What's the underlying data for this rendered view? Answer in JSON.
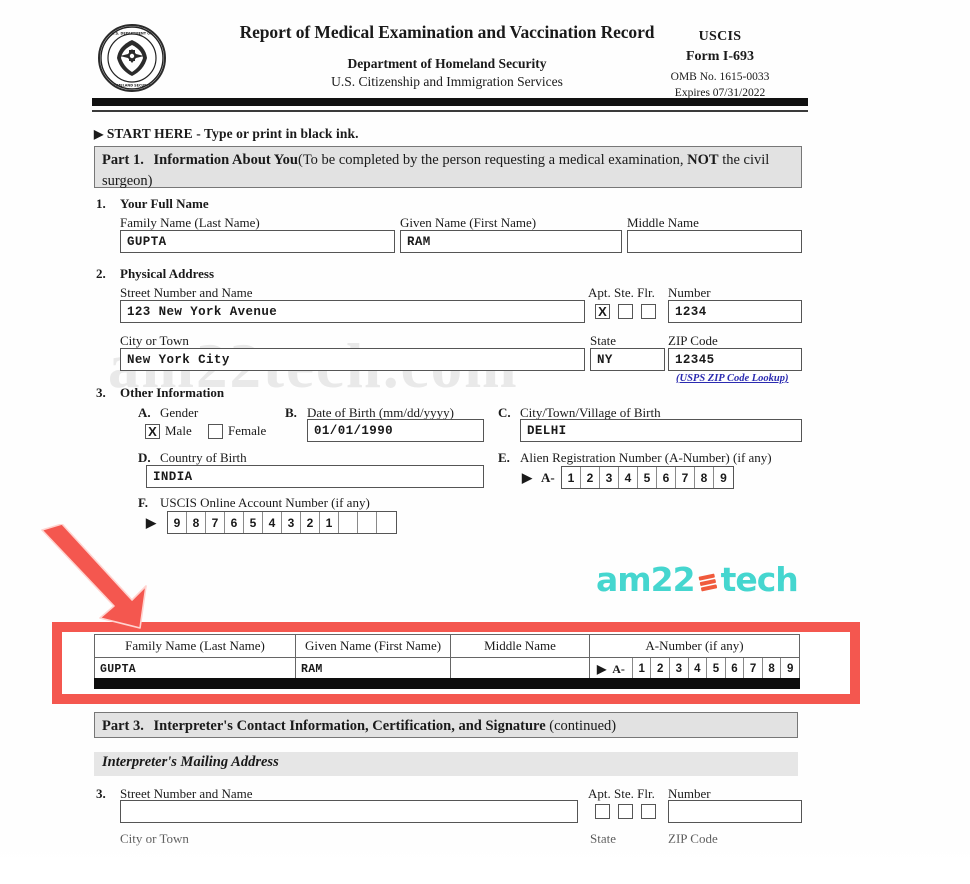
{
  "document": {
    "title": "Report of Medical Examination and Vaccination Record",
    "department": "Department of Homeland Security",
    "agency": "U.S. Citizenship and Immigration Services",
    "seal_alt": "dhs-seal",
    "agency_short": "USCIS",
    "form_number": "Form I-693",
    "omb": "OMB No. 1615-0033",
    "expires": "Expires 07/31/2022",
    "start_here": "START HERE - Type or print in black ink.",
    "start_here_marker": "▶"
  },
  "part1": {
    "label": "Part 1.",
    "title": "Information About You",
    "note_pre": "(To be completed by the person requesting a medical examination, ",
    "note_bold": "NOT",
    "note_post": " the civil surgeon)"
  },
  "item1": {
    "number": "1.",
    "heading": "Your Full Name",
    "family_label": "Family Name (Last Name)",
    "family_value": "GUPTA",
    "given_label": "Given Name (First Name)",
    "given_value": "RAM",
    "middle_label": "Middle Name",
    "middle_value": ""
  },
  "item2": {
    "number": "2.",
    "heading": "Physical Address",
    "street_label": "Street Number and Name",
    "street_value": "123 New York Avenue",
    "unit_label": "Apt. Ste. Flr.",
    "unit_apt_mark": "X",
    "unit_ste_mark": "",
    "unit_flr_mark": "",
    "number_label": "Number",
    "number_value": "1234",
    "city_label": "City or Town",
    "city_value": "New York City",
    "state_label": "State",
    "state_value": "NY",
    "zip_label": "ZIP Code",
    "zip_value": "12345",
    "zip_lookup": "(USPS ZIP Code Lookup)"
  },
  "item3": {
    "number": "3.",
    "heading": "Other Information",
    "a": {
      "letter": "A.",
      "label": "Gender",
      "male_label": "Male",
      "male_mark": "X",
      "female_label": "Female",
      "female_mark": ""
    },
    "b": {
      "letter": "B.",
      "label": "Date of Birth (mm/dd/yyyy)",
      "value": "01/01/1990"
    },
    "c": {
      "letter": "C.",
      "label": "City/Town/Village of Birth",
      "value": "DELHI"
    },
    "d": {
      "letter": "D.",
      "label": "Country of Birth",
      "value": "INDIA"
    },
    "e": {
      "letter": "E.",
      "label": "Alien Registration Number (A-Number) (if any)",
      "marker": "▶",
      "prefix": "A-",
      "digits": [
        "1",
        "2",
        "3",
        "4",
        "5",
        "6",
        "7",
        "8",
        "9"
      ]
    },
    "f": {
      "letter": "F.",
      "label": "USCIS Online Account Number (if any)",
      "marker": "▶",
      "digits": [
        "9",
        "8",
        "7",
        "6",
        "5",
        "4",
        "3",
        "2",
        "1",
        "",
        "",
        ""
      ]
    }
  },
  "highlight": {
    "headers": [
      "Family Name (Last Name)",
      "Given Name (First Name)",
      "Middle Name",
      "A-Number (if any)"
    ],
    "family_value": "GUPTA",
    "given_value": "RAM",
    "middle_value": "",
    "anumber_marker": "▶",
    "anumber_prefix": "A-",
    "anumber_digits": [
      "1",
      "2",
      "3",
      "4",
      "5",
      "6",
      "7",
      "8",
      "9"
    ],
    "frame_color": "#f4574f",
    "arrow_color": "#f4574f"
  },
  "part3": {
    "label": "Part 3.",
    "title": "Interpreter's Contact Information, Certification, and Signature",
    "continued": "(continued)",
    "subheading": "Interpreter's Mailing Address",
    "item": {
      "number": "3.",
      "street_label": "Street Number and Name",
      "street_value": "",
      "unit_label": "Apt. Ste. Flr.",
      "number_label": "Number",
      "number_value": "",
      "city_label": "City or Town",
      "state_label": "State",
      "zip_label": "ZIP Code"
    }
  },
  "branding": {
    "watermark": "am22tech.com",
    "logo_left": "am22",
    "logo_right": "tech",
    "logo_color": "#45d6cf",
    "logo_icon_color": "#f05a3c",
    "logo_icon_name": "stacked-cards-icon"
  }
}
